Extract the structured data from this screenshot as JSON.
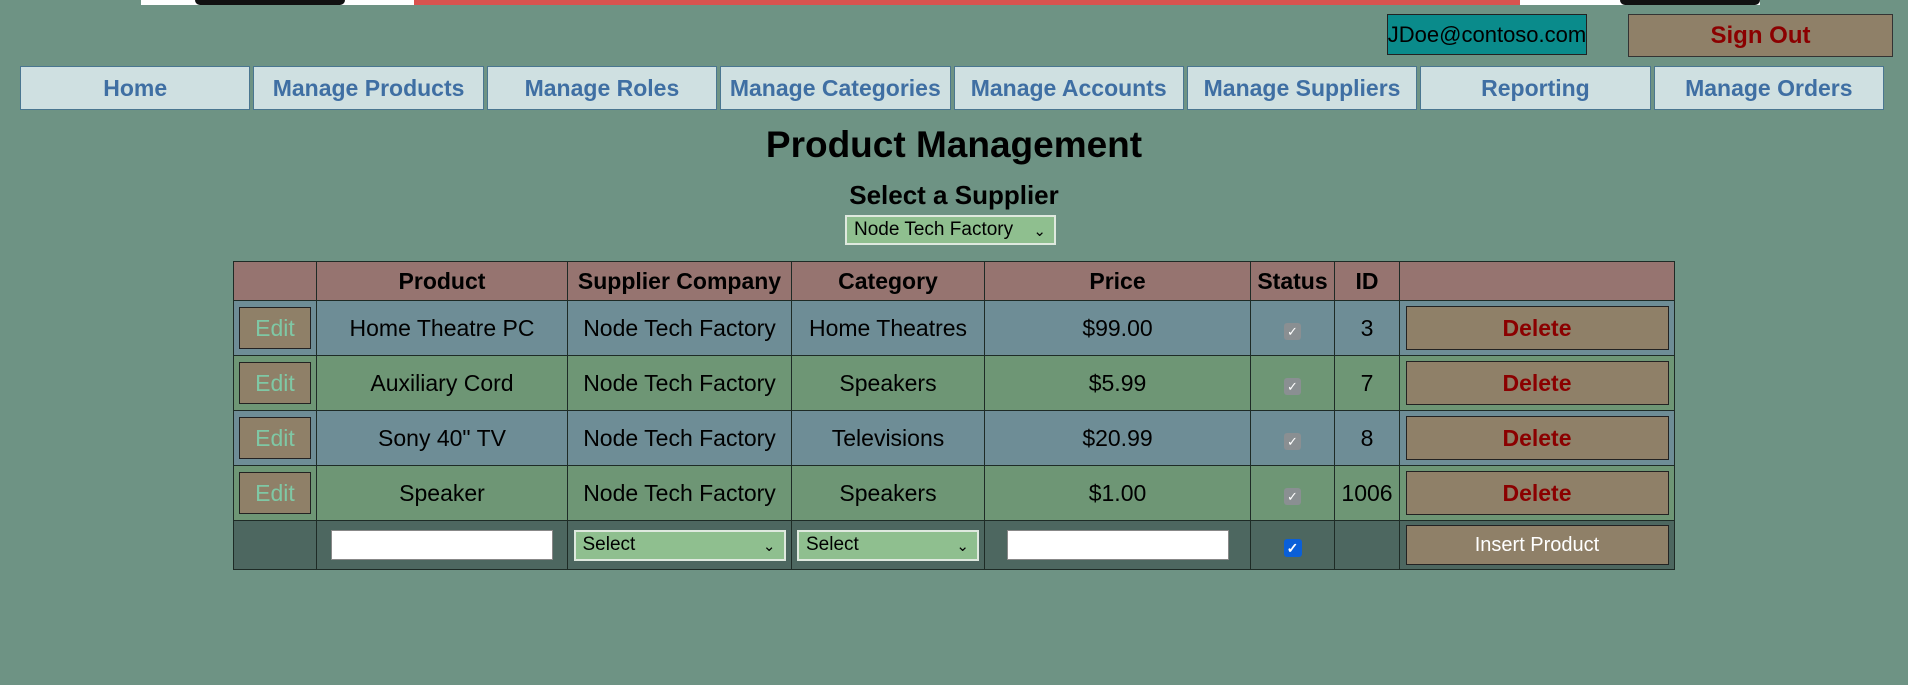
{
  "header": {
    "user_email": "JDoe@contoso.com",
    "sign_out_label": "Sign Out"
  },
  "nav": {
    "items": [
      "Home",
      "Manage Products",
      "Manage Roles",
      "Manage Categories",
      "Manage Accounts",
      "Manage Suppliers",
      "Reporting",
      "Manage Orders"
    ]
  },
  "page": {
    "title": "Product Management",
    "supplier_label": "Select a Supplier",
    "supplier_selected": "Node Tech Factory"
  },
  "table": {
    "columns": [
      "",
      "Product",
      "Supplier Company",
      "Category",
      "Price",
      "Status",
      "ID",
      ""
    ],
    "edit_label": "Edit",
    "delete_label": "Delete",
    "rows": [
      {
        "product": "Home Theatre PC",
        "supplier": "Node Tech Factory",
        "category": "Home Theatres",
        "price": "$99.00",
        "status": true,
        "id": "3"
      },
      {
        "product": "Auxiliary Cord",
        "supplier": "Node Tech Factory",
        "category": "Speakers",
        "price": "$5.99",
        "status": true,
        "id": "7"
      },
      {
        "product": "Sony 40\" TV",
        "supplier": "Node Tech Factory",
        "category": "Televisions",
        "price": "$20.99",
        "status": true,
        "id": "8"
      },
      {
        "product": "Speaker",
        "supplier": "Node Tech Factory",
        "category": "Speakers",
        "price": "$1.00",
        "status": true,
        "id": "1006"
      }
    ],
    "insert_row": {
      "supplier_select": "Select",
      "category_select": "Select",
      "status_checked": true,
      "insert_label": "Insert Product"
    }
  },
  "icons": {
    "dropdown": "chevron-down-icon",
    "status_check": "checkmark-icon"
  },
  "colors": {
    "background": "#6e9384",
    "nav_text": "#3f6fa3",
    "delete_text": "#8b0000",
    "header_row": "#967470"
  }
}
